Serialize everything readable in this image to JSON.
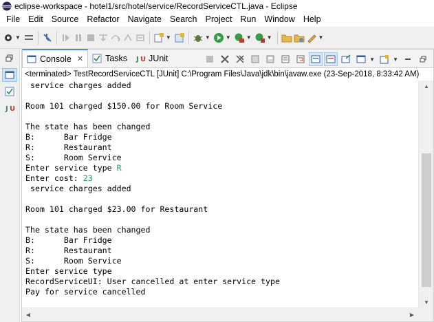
{
  "window": {
    "title": "eclipse-workspace - hotel1/src/hotel/service/RecordServiceCTL.java - Eclipse"
  },
  "menu": [
    "File",
    "Edit",
    "Source",
    "Refactor",
    "Navigate",
    "Search",
    "Project",
    "Run",
    "Window",
    "Help"
  ],
  "toolbar": {
    "icons": [
      "new-icon",
      "save-icon",
      "debug-skip-icon",
      "resume-icon",
      "suspend-icon",
      "terminate-icon",
      "step-into-icon",
      "step-over-icon",
      "step-return-icon",
      "drop-frame-icon",
      "new-type-icon",
      "debug-icon",
      "run-icon",
      "coverage-icon",
      "open-task-icon",
      "annotation-icon"
    ]
  },
  "views": {
    "tabs": [
      {
        "label": "Console",
        "icon": "console-icon",
        "active": true,
        "close": "✕"
      },
      {
        "label": "Tasks",
        "icon": "tasks-icon",
        "active": false
      },
      {
        "label": "JUnit",
        "icon": "junit-icon",
        "active": false
      }
    ]
  },
  "console": {
    "status": "<terminated> TestRecordServiceCTL [JUnit] C:\\Program Files\\Java\\jdk\\bin\\javaw.exe (23-Sep-2018, 8:33:42 AM)",
    "lines": [
      {
        "text": " service charges added"
      },
      {
        "text": ""
      },
      {
        "text": "Room 101 charged $150.00 for Room Service"
      },
      {
        "text": ""
      },
      {
        "text": "The state has been changed"
      },
      {
        "text": "B:      Bar Fridge"
      },
      {
        "text": "R:      Restaurant"
      },
      {
        "text": "S:      Room Service"
      },
      {
        "text": "Enter service type ",
        "input": "R"
      },
      {
        "text": "Enter cost: ",
        "input": "23"
      },
      {
        "text": " service charges added"
      },
      {
        "text": ""
      },
      {
        "text": "Room 101 charged $23.00 for Restaurant"
      },
      {
        "text": ""
      },
      {
        "text": "The state has been changed"
      },
      {
        "text": "B:      Bar Fridge"
      },
      {
        "text": "R:      Restaurant"
      },
      {
        "text": "S:      Room Service"
      },
      {
        "text": "Enter service type"
      },
      {
        "text": "RecordServiceUI: User cancelled at enter service type"
      },
      {
        "text": "Pay for service cancelled"
      }
    ]
  },
  "colors": {
    "input_text": "#1aa06d",
    "active_tab_accent": "#3d8fd6"
  }
}
